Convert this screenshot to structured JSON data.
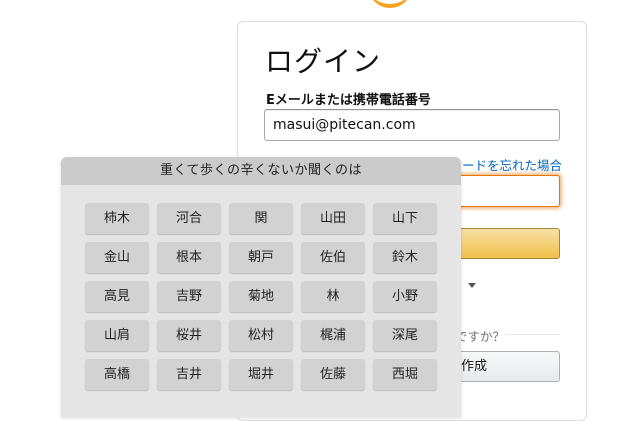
{
  "signin": {
    "title": "ログイン",
    "email_label": "Eメールまたは携帯電話番号",
    "email_value": "masui@pitecan.com",
    "forgot_password": "ードを忘れた場合",
    "new_question": "ですか？",
    "create_account": "作成"
  },
  "picker": {
    "title": "重くて歩くの辛くないか聞くのは",
    "names": [
      "柿木",
      "河合",
      "関",
      "山田",
      "山下",
      "金山",
      "根本",
      "朝戸",
      "佐伯",
      "鈴木",
      "高見",
      "吉野",
      "菊地",
      "林",
      "小野",
      "山肩",
      "桜井",
      "松村",
      "梶浦",
      "深尾",
      "高橋",
      "吉井",
      "堀井",
      "佐藤",
      "西堀"
    ]
  },
  "colors": {
    "link": "#0066c0",
    "focus_border": "#e77600",
    "signin_button": "#f0c14b",
    "logo_accent": "#f7a31c"
  }
}
